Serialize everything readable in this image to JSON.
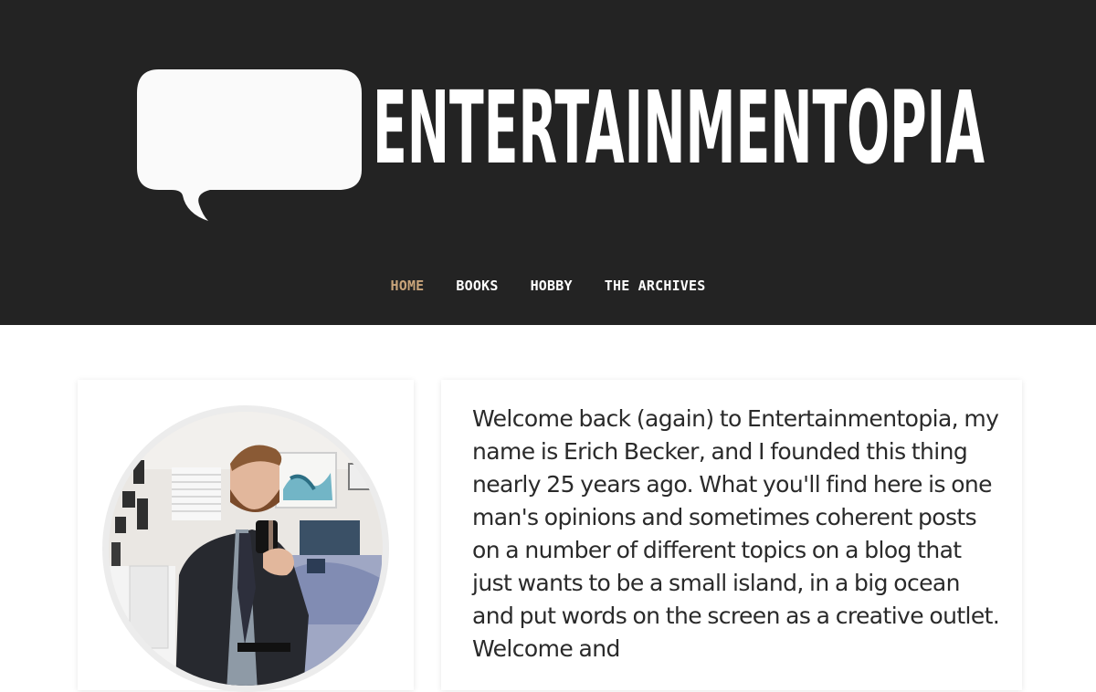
{
  "site": {
    "title": "ENTERTAINMENTOPIA",
    "colors": {
      "header_bg": "#232323",
      "accent": "#c9a47a",
      "text": "#2a2a2a"
    },
    "logo_icon": "speech-bubble-icon"
  },
  "nav": {
    "items": [
      {
        "label": "HOME",
        "active": true
      },
      {
        "label": "BOOKS",
        "active": false
      },
      {
        "label": "HOBBY",
        "active": false
      },
      {
        "label": "THE ARCHIVES",
        "active": false
      }
    ]
  },
  "profile": {
    "avatar_icon": "profile-photo"
  },
  "intro": {
    "text": "Welcome back (again) to Entertainmentopia, my name is Erich Becker, and I founded this thing nearly 25 years ago. What you'll find here is one man's opinions and sometimes coherent posts on a number of different topics on a blog that just wants to be a small island, in a big ocean and put words on the screen as a creative outlet. Welcome and"
  }
}
